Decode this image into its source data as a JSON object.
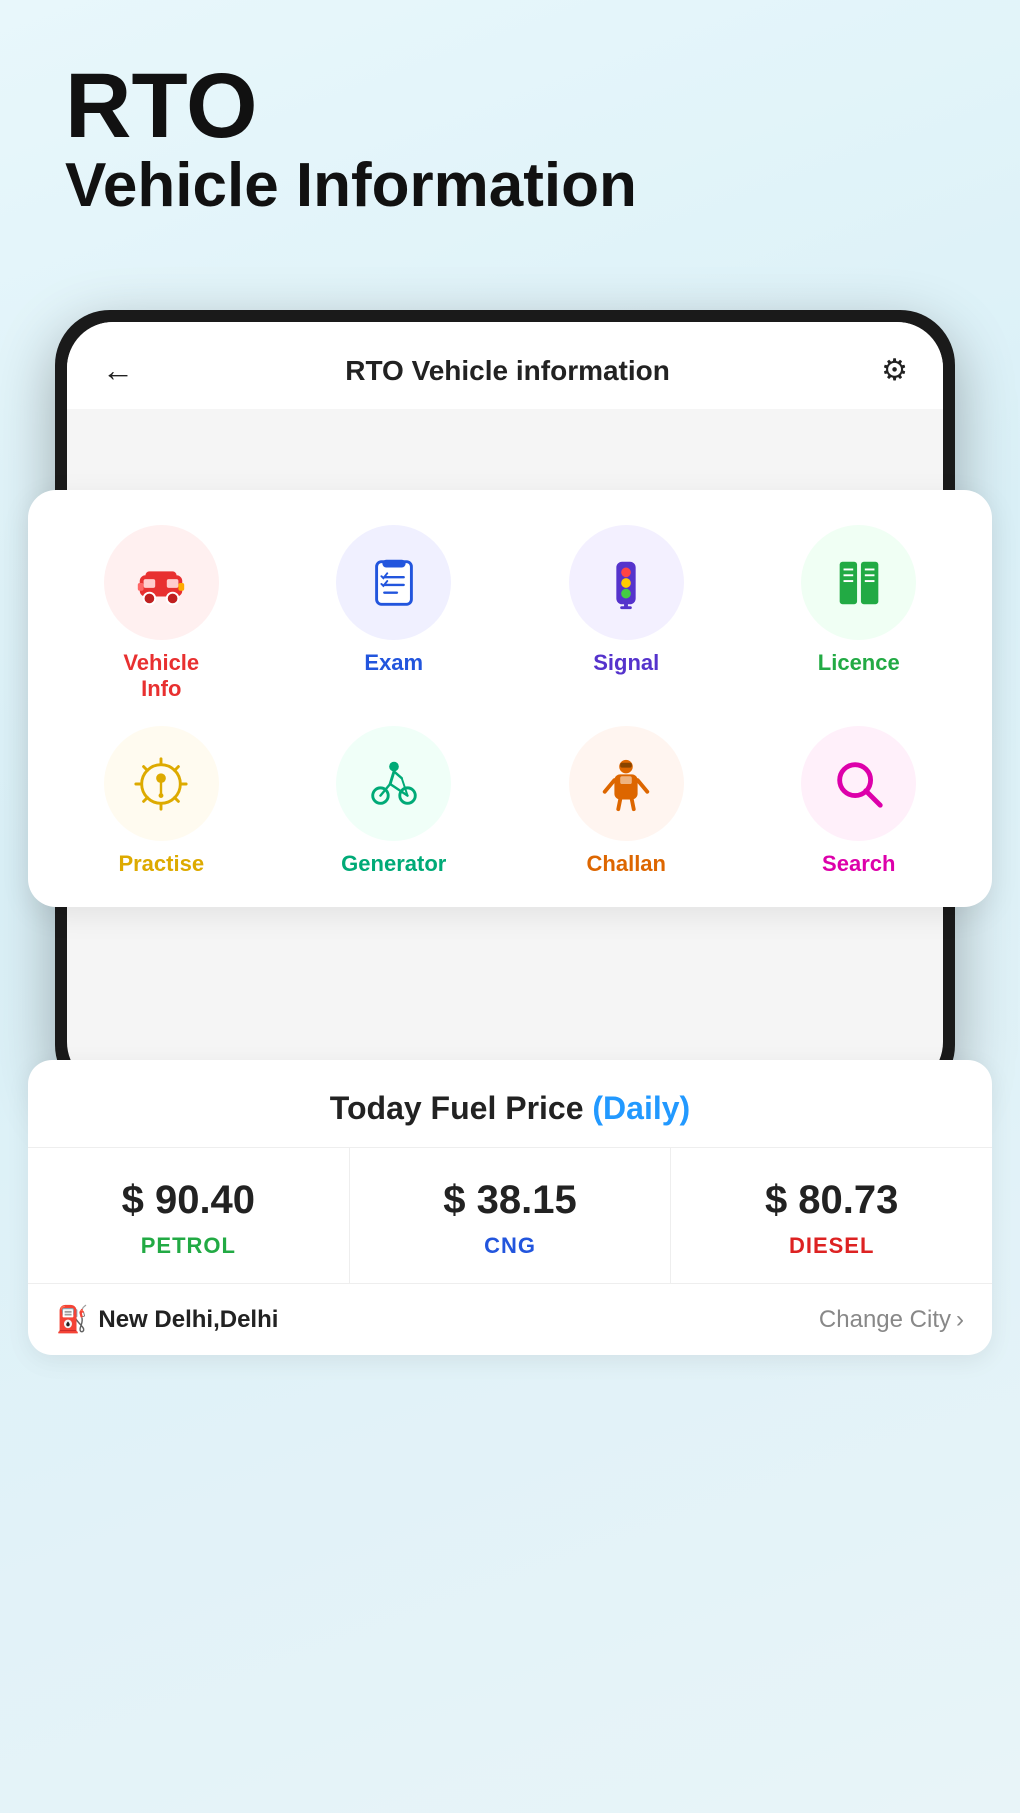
{
  "header": {
    "rto": "RTO",
    "subtitle": "Vehicle Information"
  },
  "appbar": {
    "title": "RTO Vehicle information",
    "back_label": "←",
    "settings_label": "⚙"
  },
  "menu": {
    "items": [
      {
        "id": "vehicle-info",
        "label": "Vehicle\nInfo",
        "label_display": "Vehicle Info",
        "color": "color-red",
        "bg": "bg-red-light"
      },
      {
        "id": "exam",
        "label": "Exam",
        "label_display": "Exam",
        "color": "color-blue",
        "bg": "bg-blue-light"
      },
      {
        "id": "signal",
        "label": "Signal",
        "label_display": "Signal",
        "color": "color-purple",
        "bg": "bg-purple-light"
      },
      {
        "id": "licence",
        "label": "Licence",
        "label_display": "Licence",
        "color": "color-green",
        "bg": "bg-green-light"
      },
      {
        "id": "practise",
        "label": "Practise",
        "label_display": "Practise",
        "color": "color-yellow",
        "bg": "bg-yellow-light"
      },
      {
        "id": "generator",
        "label": "Generator",
        "label_display": "Generator",
        "color": "color-teal",
        "bg": "bg-teal-light"
      },
      {
        "id": "challan",
        "label": "Challan",
        "label_display": "Challan",
        "color": "color-orange",
        "bg": "bg-orange-light"
      },
      {
        "id": "search",
        "label": "Search",
        "label_display": "Search",
        "color": "color-pink",
        "bg": "bg-pink-light"
      }
    ]
  },
  "fuel": {
    "title": "Today Fuel Price",
    "daily_label": "(Daily)",
    "petrol": {
      "amount": "$ 90.40",
      "label": "PETROL",
      "color": "#22aa44"
    },
    "cng": {
      "amount": "$ 38.15",
      "label": "CNG",
      "color": "#2255dd"
    },
    "diesel": {
      "amount": "$ 80.73",
      "label": "DIESEL",
      "color": "#dd2222"
    },
    "city": "New Delhi,Delhi",
    "change_city": "Change City"
  }
}
